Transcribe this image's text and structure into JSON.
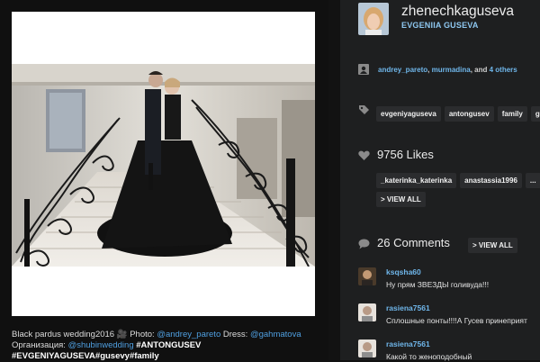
{
  "profile": {
    "username": "zhenechkaguseva",
    "fullname": "EVGENIIA GUSEVA"
  },
  "people": {
    "user1": "andrey_pareto",
    "user2": "murmadina",
    "sep": ", ",
    "and": ", and ",
    "others": "4 others"
  },
  "tags": [
    "evgeniyaguseva",
    "antongusev",
    "family",
    "gu"
  ],
  "likes": {
    "title": "9756 Likes",
    "likers": [
      "_katerinka_katerinka",
      "anastassia1996",
      "..."
    ],
    "view_all": "> VIEW ALL"
  },
  "comments": {
    "title": "26 Comments",
    "view_all": "> VIEW ALL",
    "items": [
      {
        "user": "ksqsha60",
        "text": "Ну прям ЗВЕЗДЫ голивуда!!!"
      },
      {
        "user": "rasiena7561",
        "text": "Сплошные понты!!!!А Гусев принеприят"
      },
      {
        "user": "rasiena7561",
        "text": "Какой то женоподобный"
      }
    ]
  },
  "caption": {
    "line1_a": "Black pardus wedding2016 ",
    "line1_icon": "🎥",
    "line1_b": " Photo: ",
    "photo_user": "@andrey_pareto",
    "dress_label": " Dress: ",
    "dress_user": "@gahmatova",
    "org_label": "Организация: ",
    "org_user": "@shubinwedding",
    "tag1": " #ANTONGUSEV",
    "tag2": "#EVGENIYAGUSEVA#gusevy#family"
  }
}
